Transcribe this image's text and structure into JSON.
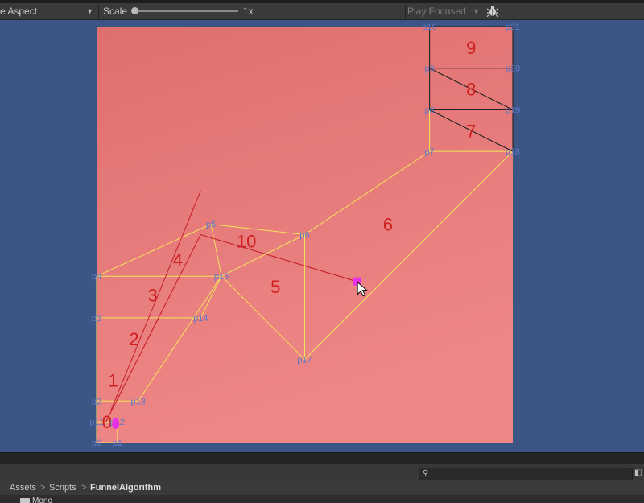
{
  "toolbar": {
    "aspect_label": "e Aspect",
    "scale_label": "Scale",
    "scale_value": "1x",
    "scale_fraction": 0.0,
    "play_mode": "Play Focused",
    "bug_icon": "bug-icon",
    "dropdown_icon": "chevron-down-icon"
  },
  "colors": {
    "scene_bg": "#3b5584",
    "board_top": "#e07272",
    "board_bottom": "#ef8686",
    "edge": "#f2e45a",
    "path": "#c41f2a",
    "label": "#cf2020",
    "point": "#5f78c8",
    "goal": "#e830e8"
  },
  "scene": {
    "board_size": 20,
    "polygon_labels": [
      "0",
      "1",
      "2",
      "3",
      "4",
      "5",
      "6",
      "7",
      "8",
      "9",
      "10"
    ],
    "points": [
      {
        "id": "p0",
        "x": 0,
        "y": 0
      },
      {
        "id": "p1",
        "x": 1,
        "y": 0
      },
      {
        "id": "p11",
        "x": 0,
        "y": 1
      },
      {
        "id": "p12",
        "x": 1,
        "y": 1
      },
      {
        "id": "p2",
        "x": 0,
        "y": 2
      },
      {
        "id": "p13",
        "x": 2,
        "y": 2
      },
      {
        "id": "p3",
        "x": 0,
        "y": 6
      },
      {
        "id": "p14",
        "x": 5,
        "y": 6
      },
      {
        "id": "p4",
        "x": 0,
        "y": 8
      },
      {
        "id": "p15",
        "x": 6,
        "y": 8
      },
      {
        "id": "p5",
        "x": 5.5,
        "y": 10.5
      },
      {
        "id": "p6",
        "x": 10,
        "y": 10
      },
      {
        "id": "p17",
        "x": 10,
        "y": 4
      },
      {
        "id": "p7",
        "x": 16,
        "y": 14
      },
      {
        "id": "p18",
        "x": 20,
        "y": 14
      },
      {
        "id": "p8",
        "x": 16,
        "y": 16
      },
      {
        "id": "p19",
        "x": 20,
        "y": 16
      },
      {
        "id": "p9",
        "x": 16,
        "y": 18
      },
      {
        "id": "p20",
        "x": 20,
        "y": 18
      },
      {
        "id": "p10",
        "x": 16,
        "y": 20
      },
      {
        "id": "p21",
        "x": 20,
        "y": 20
      }
    ],
    "start": {
      "x": 0.45,
      "y": 1
    },
    "goal": {
      "x": 12.5,
      "y": 7.75
    }
  },
  "project": {
    "search_placeholder": "",
    "breadcrumb": [
      "Assets",
      "Scripts",
      "FunnelAlgorithm"
    ],
    "breadcrumb_separator": ">",
    "folder_name": "Mono",
    "search_icon": "search-icon",
    "folder_icon": "folder-icon"
  }
}
